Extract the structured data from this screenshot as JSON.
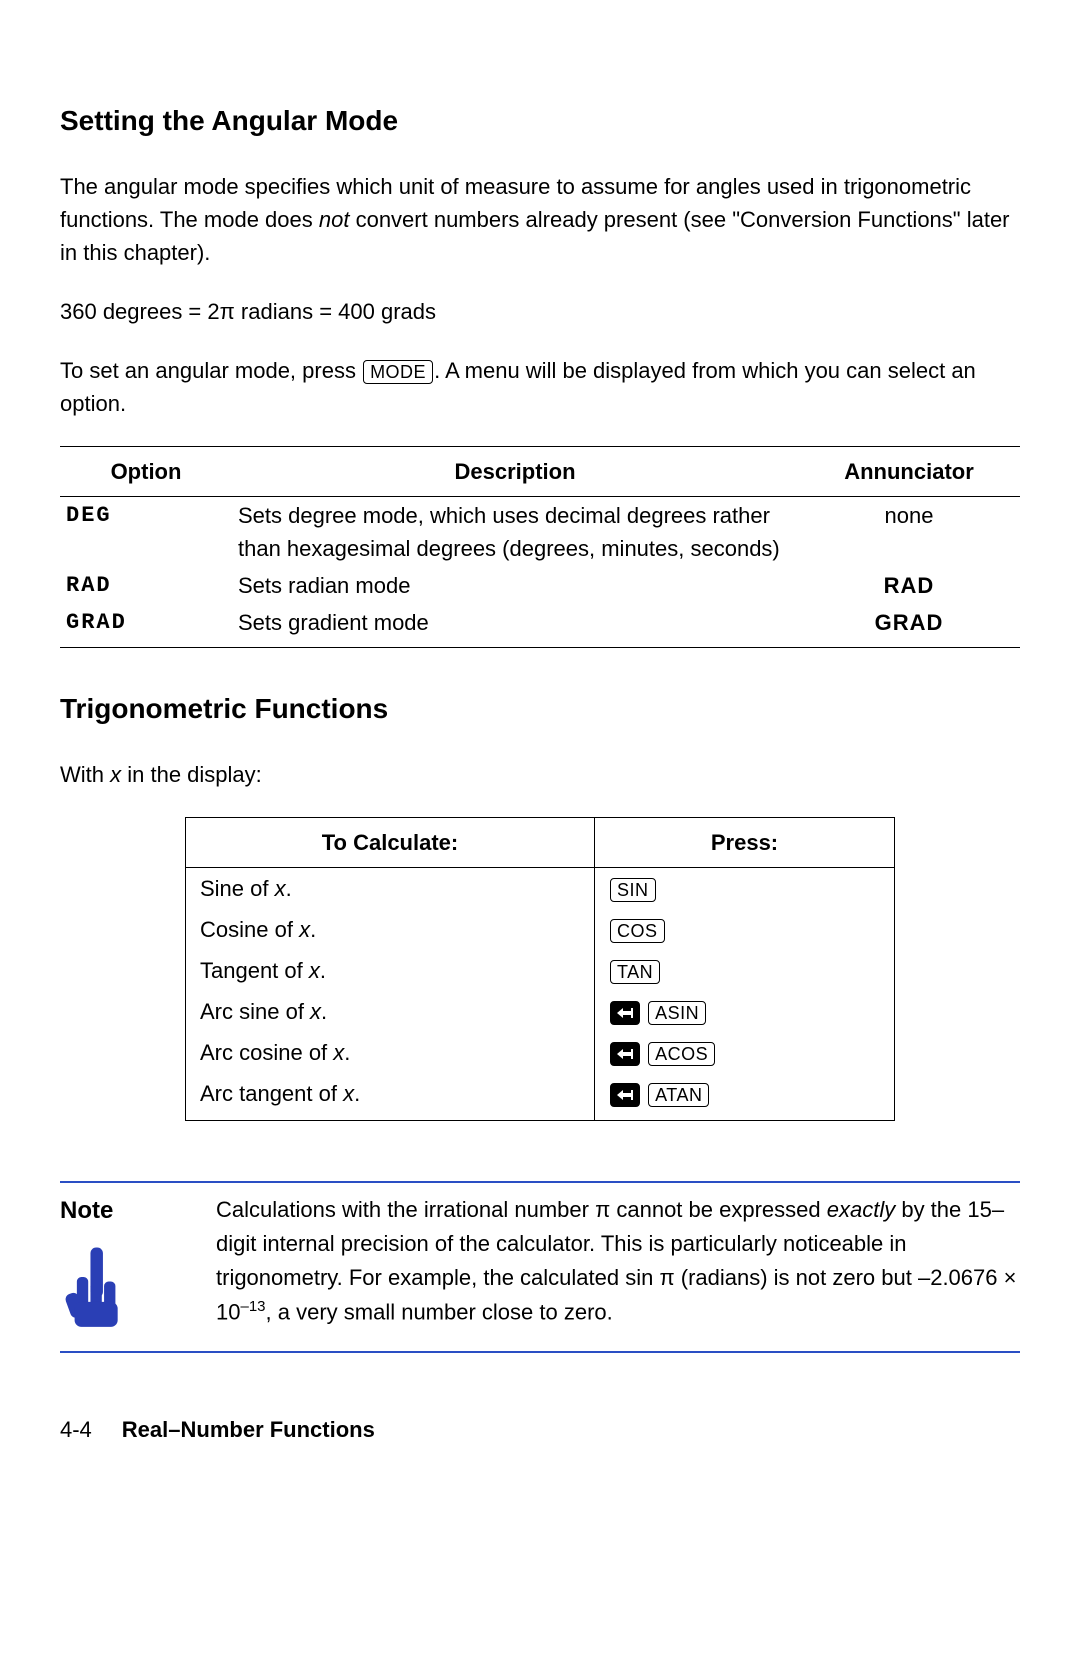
{
  "section1": {
    "heading": "Setting the Angular Mode",
    "p1a": "The angular mode specifies which unit of measure to assume for angles used in trigonometric functions. The mode does ",
    "p1_not": "not",
    "p1b": " convert numbers already present (see \"Conversion Functions\" later in this chapter).",
    "p2": "360 degrees = 2π radians = 400 grads",
    "p3a": "To set an angular mode, press ",
    "p3_key": "MODE",
    "p3b": ". A menu will be displayed from which you can select an option."
  },
  "modes_table": {
    "headers": [
      "Option",
      "Description",
      "Annunciator"
    ],
    "rows": [
      {
        "option": "DEG",
        "desc": "Sets degree mode, which uses decimal degrees rather than hexagesimal degrees (degrees, minutes, seconds)",
        "annun": "none",
        "annun_bold": false
      },
      {
        "option": "RAD",
        "desc": "Sets radian mode",
        "annun": "RAD",
        "annun_bold": true
      },
      {
        "option": "GRAD",
        "desc": "Sets gradient mode",
        "annun": "GRAD",
        "annun_bold": true
      }
    ]
  },
  "section2": {
    "heading": "Trigonometric Functions",
    "intro_a": "With ",
    "intro_x": "x",
    "intro_b": " in the display:"
  },
  "trig_table": {
    "headers": [
      "To Calculate:",
      "Press:"
    ],
    "rows": [
      {
        "calc_a": "Sine of ",
        "calc_x": "x",
        "calc_b": ".",
        "shift": false,
        "key": "SIN"
      },
      {
        "calc_a": "Cosine of ",
        "calc_x": "x",
        "calc_b": ".",
        "shift": false,
        "key": "COS"
      },
      {
        "calc_a": "Tangent of ",
        "calc_x": "x",
        "calc_b": ".",
        "shift": false,
        "key": "TAN"
      },
      {
        "calc_a": "Arc sine of ",
        "calc_x": "x",
        "calc_b": ".",
        "shift": true,
        "key": "ASIN"
      },
      {
        "calc_a": "Arc cosine of ",
        "calc_x": "x",
        "calc_b": ".",
        "shift": true,
        "key": "ACOS"
      },
      {
        "calc_a": "Arc tangent of ",
        "calc_x": "x",
        "calc_b": ".",
        "shift": true,
        "key": "ATAN"
      }
    ]
  },
  "note": {
    "label": "Note",
    "text_a": "Calculations with the irrational number π cannot be expressed ",
    "text_exactly": "exactly",
    "text_b": " by the 15–digit internal precision of the calculator. This is particularly noticeable in trigonometry. For example, the calculated sin π (radians) is not zero but –2.0676 × 10",
    "text_exp": "–13",
    "text_c": ", a very small number close to zero."
  },
  "footer": {
    "page": "4-4",
    "chapter": "Real–Number Functions"
  }
}
